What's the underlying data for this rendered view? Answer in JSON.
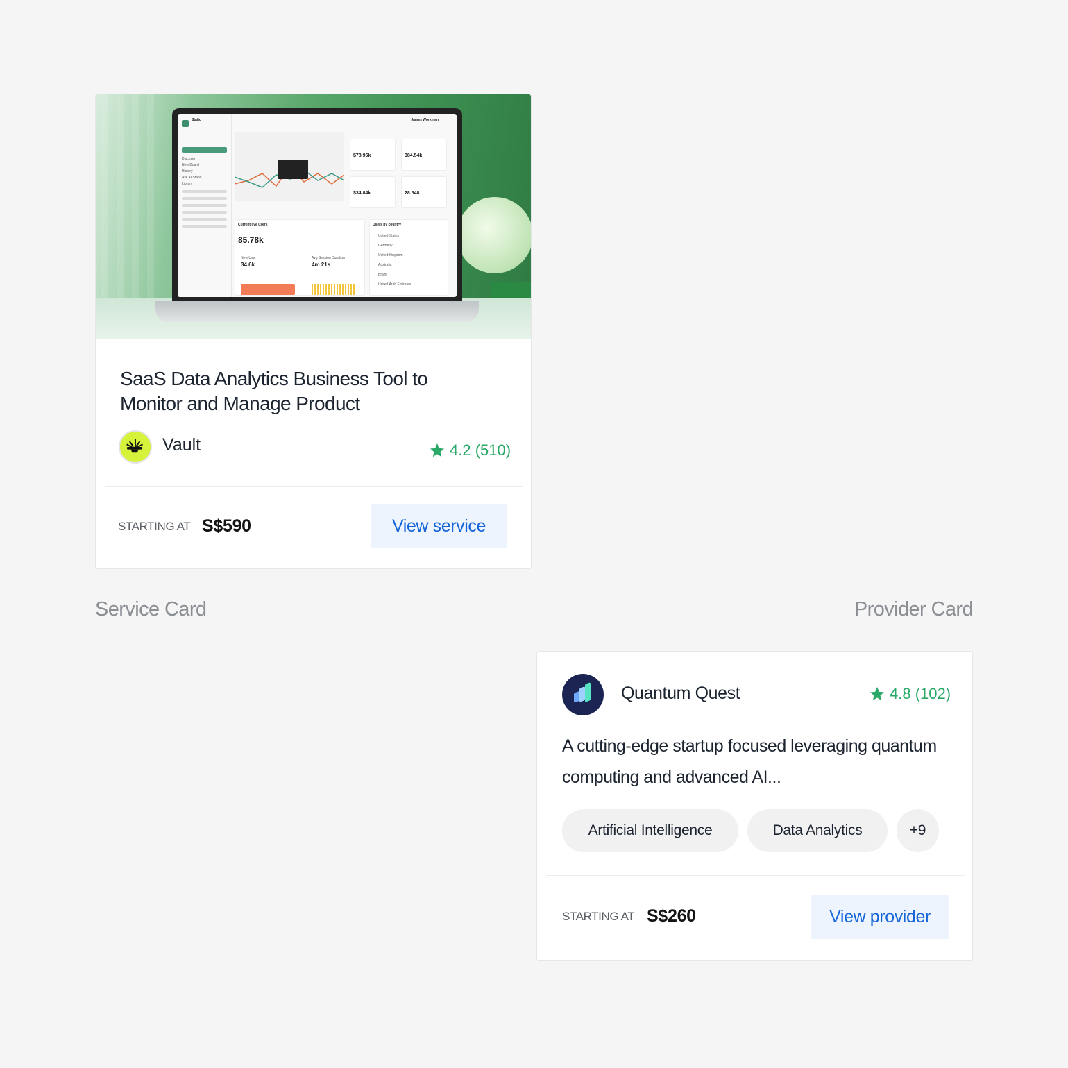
{
  "service_card": {
    "title": "SaaS Data Analytics Business Tool to Monitor and Manage Product",
    "provider_name": "Vault",
    "rating": "4.2 (510)",
    "starting_label": "STARTING AT",
    "price": "S$590",
    "button_label": "View service",
    "screenshot": {
      "app_name": "Statio",
      "nav": [
        "Home",
        "Discover",
        "New Board",
        "History",
        "Ask AI Statio",
        "Library"
      ],
      "user": "James Workman",
      "stats": [
        {
          "label": "Visitors",
          "value": "$78.96k"
        },
        {
          "label": "Sales Product",
          "value": "384.54k"
        },
        {
          "label": "Order Value",
          "value": "$34.84k"
        },
        {
          "label": "Active User",
          "value": "28.548"
        }
      ],
      "live_users_title": "Current live users",
      "live_users_value": "85.78k",
      "new_user_label": "New User",
      "new_user_value": "34.6k",
      "session_label": "Avg Session Duration",
      "session_value": "4m 21s",
      "countries_title": "Users by country",
      "countries": [
        "United States",
        "Germany",
        "United Kingdom",
        "Australia",
        "Brazil",
        "United Arab Emirates"
      ]
    }
  },
  "labels": {
    "service_card": "Service Card",
    "provider_card": "Provider Card"
  },
  "provider_card": {
    "name": "Quantum Quest",
    "rating": "4.8 (102)",
    "description": "A cutting-edge startup focused leveraging quantum computing and advanced AI...",
    "tags": [
      "Artificial Intelligence",
      "Data Analytics",
      "+9"
    ],
    "starting_label": "STARTING AT",
    "price": "S$260",
    "button_label": "View provider"
  },
  "colors": {
    "accent_blue": "#1565d8",
    "button_bg": "#edf4fd",
    "rating_green": "#2aa867",
    "vault_logo": "#d6f23b",
    "quantum_logo": "#1b2452"
  }
}
